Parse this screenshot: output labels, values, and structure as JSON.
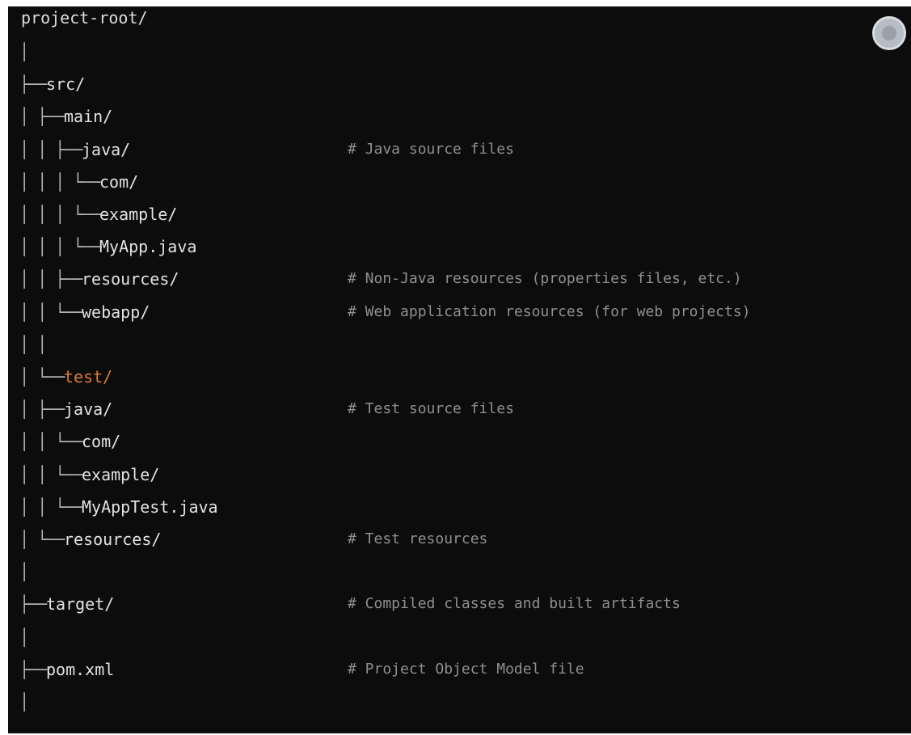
{
  "root_label": "project-root/",
  "tree": [
    {
      "prefix": "│",
      "name": "",
      "comment": ""
    },
    {
      "prefix": "├── ",
      "name": "src/",
      "comment": ""
    },
    {
      "prefix": "│   ├── ",
      "name": "main/",
      "comment": ""
    },
    {
      "prefix": "│   │   ├── ",
      "name": "java/",
      "comment": "# Java source files"
    },
    {
      "prefix": "│   │   │   └── ",
      "name": "com/",
      "comment": ""
    },
    {
      "prefix": "│   │   │       └── ",
      "name": "example/",
      "comment": ""
    },
    {
      "prefix": "│   │   │           └── ",
      "name": "MyApp.java",
      "comment": ""
    },
    {
      "prefix": "│   │   ├── ",
      "name": "resources/",
      "comment": "# Non-Java resources (properties files, etc.)"
    },
    {
      "prefix": "│   │   └── ",
      "name": "webapp/",
      "comment": "# Web application resources (for web projects)"
    },
    {
      "prefix": "│   │",
      "name": "",
      "comment": ""
    },
    {
      "prefix": "│   └── ",
      "name": "test/",
      "comment": "",
      "highlight": true
    },
    {
      "prefix": "│       ├── ",
      "name": "java/",
      "comment": "# Test source files"
    },
    {
      "prefix": "│       │   └── ",
      "name": "com/",
      "comment": ""
    },
    {
      "prefix": "│       │       └── ",
      "name": "example/",
      "comment": ""
    },
    {
      "prefix": "│       │           └── ",
      "name": "MyAppTest.java",
      "comment": ""
    },
    {
      "prefix": "│       └── ",
      "name": "resources/",
      "comment": "# Test resources"
    },
    {
      "prefix": "│",
      "name": "",
      "comment": ""
    },
    {
      "prefix": "├── ",
      "name": "target/",
      "comment": "# Compiled classes and built artifacts"
    },
    {
      "prefix": "│",
      "name": "",
      "comment": ""
    },
    {
      "prefix": "├── ",
      "name": "pom.xml",
      "comment": "# Project Object Model file"
    },
    {
      "prefix": "│",
      "name": "",
      "comment": ""
    }
  ],
  "colors": {
    "background": "#0c0c0c",
    "text": "#e2e2e2",
    "highlight": "#e07a2e",
    "comment": "#8f8f8f"
  },
  "icons": {
    "avatar": "user-avatar-icon"
  }
}
